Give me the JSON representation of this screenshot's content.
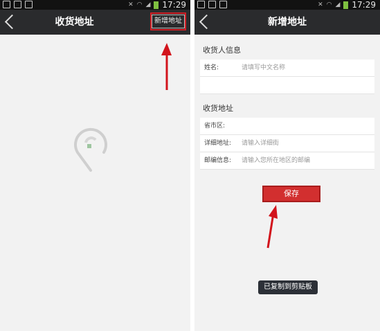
{
  "left_screen": {
    "status_time": "17:29",
    "title": "收货地址",
    "add_button_label": "新增地址"
  },
  "right_screen": {
    "status_time": "17:29",
    "title": "新增地址",
    "receiver_section_title": "收货人信息",
    "name_label": "姓名:",
    "name_placeholder": "请填写中文名称",
    "phone_value": "",
    "address_section_title": "收货地址",
    "region_label": "省市区:",
    "detail_label": "详细地址:",
    "detail_placeholder": "请输入详细街",
    "zip_label": "邮编信息:",
    "zip_placeholder": "请输入您所在地区的邮编",
    "save_label": "保存",
    "toast": "已复制到剪贴板"
  },
  "colors": {
    "titlebar": "#2a2b2d",
    "highlight_red": "#d21f26",
    "save_red": "#d22f2f"
  }
}
